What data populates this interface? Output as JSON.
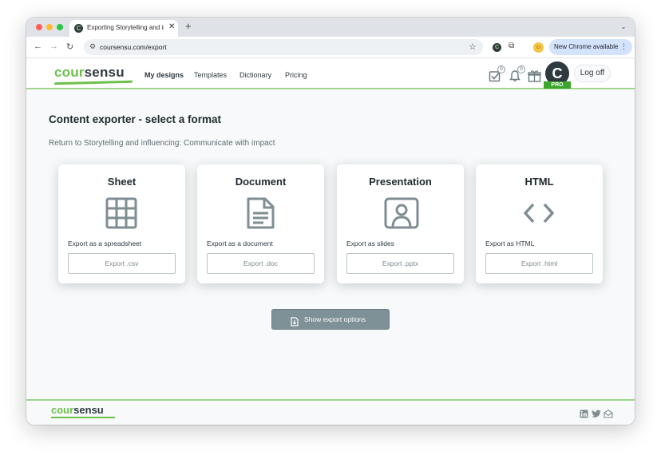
{
  "browser": {
    "tab_title": "Exporting Storytelling and influ",
    "new_tab_glyph": "+",
    "url": "coursensu.com/export",
    "update_label": "New Chrome available"
  },
  "site": {
    "logo_part1": "cour",
    "logo_part2": "sensu",
    "nav": [
      "My designs",
      "Templates",
      "Dictionary",
      "Pricing"
    ],
    "badges": {
      "tasks": "0",
      "notifications": "0"
    },
    "avatar_letter": "C",
    "pro_label": "PRO",
    "logoff_label": "Log off"
  },
  "page": {
    "title": "Content exporter - select a format",
    "return_link": "Return to Storytelling and influencing: Communicate with impact",
    "cards": [
      {
        "title": "Sheet",
        "icon": "table-grid-icon",
        "desc": "Export as a spreadsheet",
        "button": "Export .csv"
      },
      {
        "title": "Document",
        "icon": "document-icon",
        "desc": "Export as a document",
        "button": "Export .doc"
      },
      {
        "title": "Presentation",
        "icon": "slides-icon",
        "desc": "Export as slides",
        "button": "Export .pptx"
      },
      {
        "title": "HTML",
        "icon": "code-icon",
        "desc": "Export as HTML",
        "button": "Export .html"
      }
    ],
    "show_export_label": "Show export options"
  },
  "footer": {
    "logo_part1": "cour",
    "logo_part2": "sensu",
    "social_icons": [
      "linkedin-icon",
      "twitter-icon",
      "email-icon"
    ]
  },
  "colors": {
    "brand_green": "#6dbf4b",
    "dark_slate": "#2e3a3f",
    "pro_green": "#3aa72c",
    "button_grey": "#7e9196"
  }
}
